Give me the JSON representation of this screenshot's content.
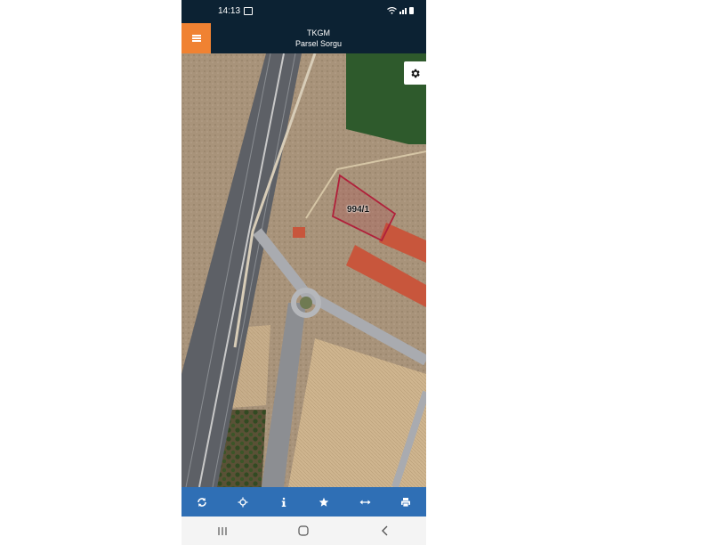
{
  "status_bar": {
    "time": "14:13",
    "icons": [
      "image-icon",
      "wifi-icon",
      "signal-icon",
      "battery-icon"
    ]
  },
  "header": {
    "title": "TKGM",
    "subtitle": "Parsel Sorgu",
    "menu_icon": "hamburger-menu-icon",
    "accent_color": "#f08232",
    "background_color": "#0c2233"
  },
  "map": {
    "parcel_label": "994/1",
    "settings_icon": "gear-icon",
    "parcel_color": "#b0203a"
  },
  "toolbar": {
    "background_color": "#2f6fb5",
    "tools": [
      "refresh-icon",
      "locate-icon",
      "info-icon",
      "star-icon",
      "measure-icon",
      "print-icon"
    ]
  },
  "android_nav": {
    "buttons": [
      "recents-icon",
      "home-icon",
      "back-icon"
    ]
  }
}
